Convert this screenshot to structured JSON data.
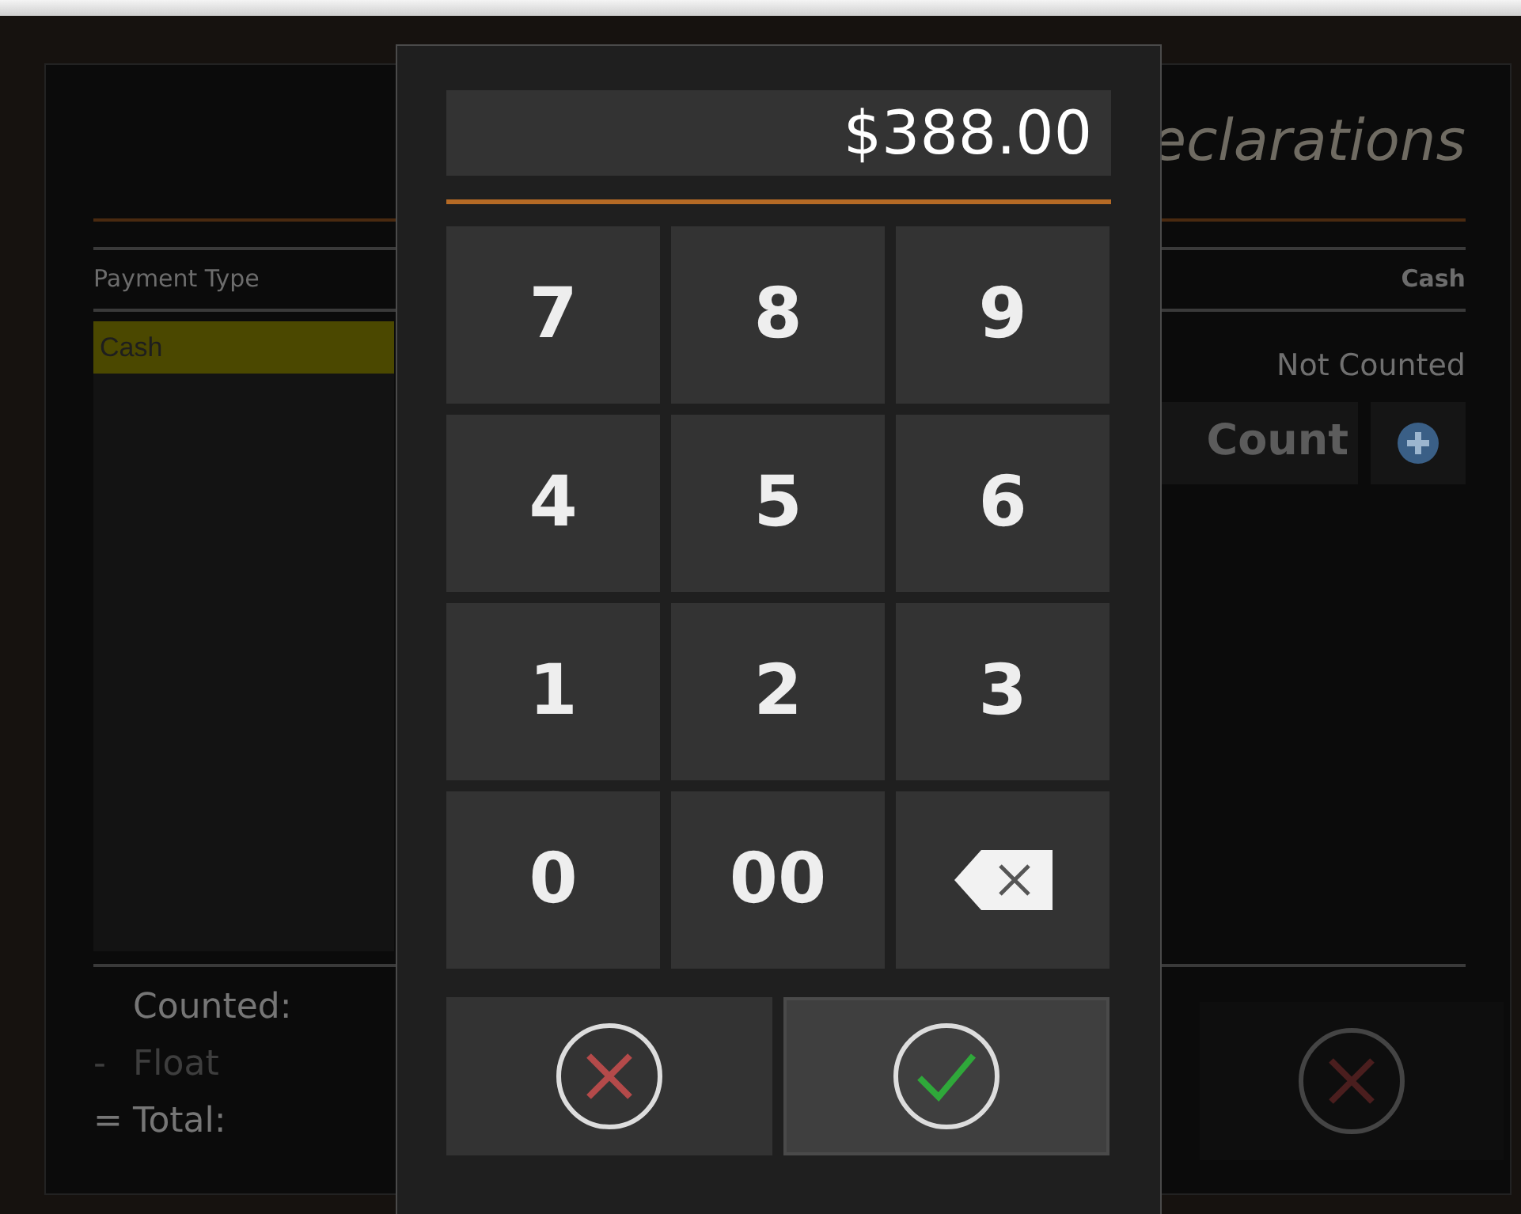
{
  "background_dialog": {
    "title": "eclarations",
    "columns": [
      "Payment Type",
      "Cash"
    ],
    "payment_types": [
      {
        "label": "Cash",
        "selected": true
      }
    ],
    "status": "Not Counted",
    "count_button": "Count",
    "totals": [
      {
        "label": "Counted:",
        "kind": "normal"
      },
      {
        "sign": "-",
        "label": "Float",
        "kind": "dim"
      },
      {
        "sign": "=",
        "label": "Total:",
        "kind": "normal"
      }
    ]
  },
  "keypad": {
    "display": "$388.00",
    "keys": [
      {
        "label": "7",
        "kind": "digit"
      },
      {
        "label": "8",
        "kind": "digit"
      },
      {
        "label": "9",
        "kind": "digit"
      },
      {
        "label": "4",
        "kind": "digit"
      },
      {
        "label": "5",
        "kind": "digit"
      },
      {
        "label": "6",
        "kind": "digit"
      },
      {
        "label": "1",
        "kind": "digit"
      },
      {
        "label": "2",
        "kind": "digit"
      },
      {
        "label": "3",
        "kind": "digit"
      },
      {
        "label": "0",
        "kind": "digit"
      },
      {
        "label": "00",
        "kind": "digit"
      },
      {
        "kind": "backspace"
      }
    ],
    "actions": [
      {
        "kind": "cancel",
        "hovered": false
      },
      {
        "kind": "confirm",
        "hovered": true
      }
    ]
  }
}
